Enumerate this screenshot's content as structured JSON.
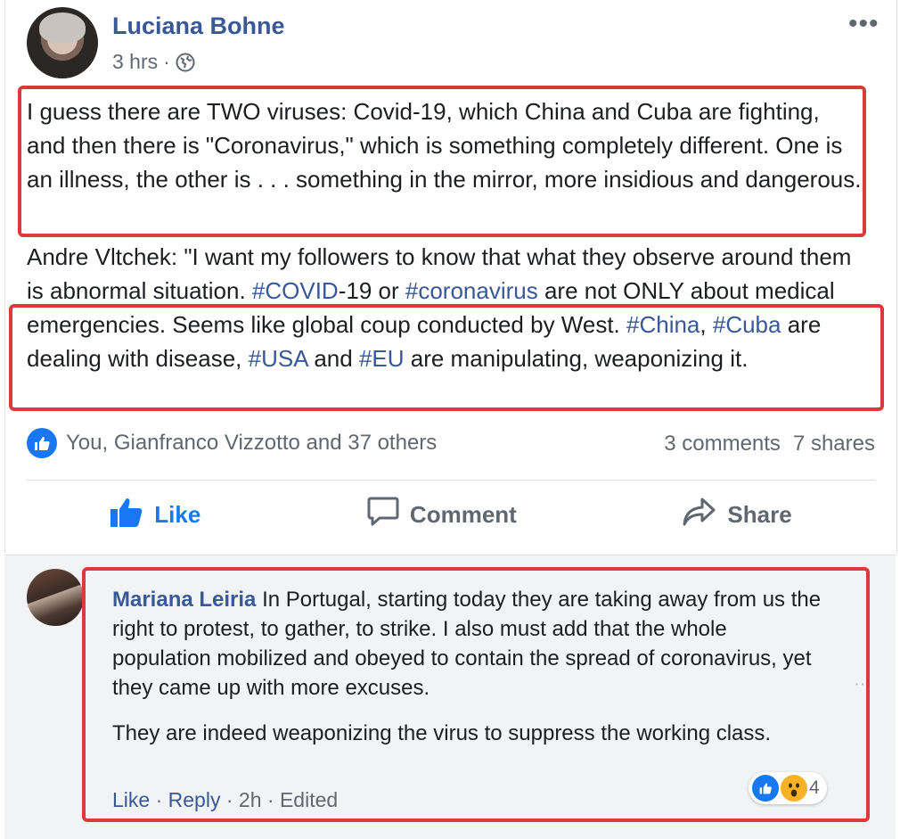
{
  "post": {
    "author": "Luciana Bohne",
    "time": "3 hrs",
    "separator": "·",
    "paragraph1": "I guess there are TWO viruses: Covid-19, which China and Cuba are fighting, and then there is \"Coronavirus,\" which is something completely different. One is an illness, the other is . . . something in the mirror, more insidious and dangerous.",
    "paragraph2": {
      "part1": "Andre Vltchek: \"I want my followers to know that what they observe around them is abnormal situation. ",
      "tag_covid": "#COVID",
      "part2": "-19 or ",
      "tag_coronavirus": "#coronavirus",
      "part3": " are not ONLY about medical emergencies. Seems like global coup conducted by West. ",
      "tag_china": "#China",
      "part4": ", ",
      "tag_cuba": "#Cuba",
      "part5": " are dealing with disease, ",
      "tag_usa": "#USA",
      "part6": " and ",
      "tag_eu": "#EU",
      "part7": " are manipulating, weaponizing it."
    },
    "reactions_text": "You, Gianfranco Vizzotto and 37 others",
    "comments_count": "3 comments",
    "shares_count": "7 shares",
    "actions": {
      "like": "Like",
      "comment": "Comment",
      "share": "Share"
    },
    "more_icon": "•••"
  },
  "comment": {
    "author": "Mariana Leiria",
    "text1": " In Portugal, starting today they are taking away from us the right to protest, to gather, to strike. I also must add that the whole population mobilized and obeyed to contain the spread of coronavirus, yet they came up with more excuses.",
    "text2": "They are indeed weaponizing the virus to suppress the working class.",
    "meta": {
      "like": "Like",
      "reply": "Reply",
      "time": "2h",
      "edited": "Edited",
      "sep": " · "
    },
    "reaction_count": "4"
  },
  "colors": {
    "accent": "#385898",
    "like_blue": "#1877f2",
    "highlight_red": "#d93a3a",
    "muted": "#606770"
  },
  "icons": [
    "globe-icon",
    "more-options-icon",
    "like-reaction-icon",
    "thumbs-up-icon",
    "comment-icon",
    "share-icon",
    "wow-reaction-icon"
  ]
}
